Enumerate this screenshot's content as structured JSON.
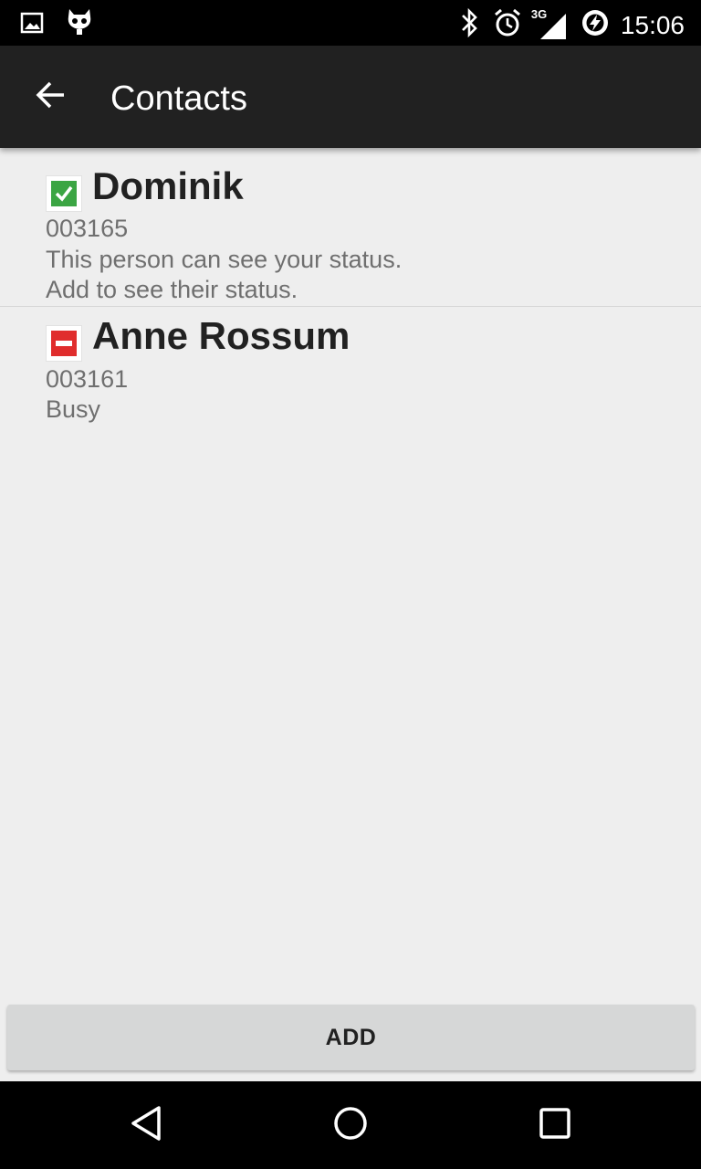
{
  "status_bar": {
    "time": "15:06",
    "network_label": "3G",
    "left_icons": [
      "image-notification-icon",
      "cyanogen-mascot-icon"
    ],
    "right_icons": [
      "bluetooth-icon",
      "alarm-icon",
      "signal-3g-icon",
      "battery-charging-icon"
    ]
  },
  "app_bar": {
    "title": "Contacts",
    "back_icon": "arrow-left-icon",
    "background": "#212121"
  },
  "contacts": [
    {
      "name": "Dominik",
      "number": "003165",
      "lines": [
        "This person can see your status.",
        "Add to see their status."
      ],
      "status_icon": "check-icon",
      "status_color": "#3ba543"
    },
    {
      "name": "Anne Rossum",
      "number": "003161",
      "lines": [
        "Busy"
      ],
      "status_icon": "busy-icon",
      "status_color": "#e02d2d"
    }
  ],
  "add_button": {
    "label": "ADD"
  },
  "nav_bar": {
    "icons": [
      "back-triangle-icon",
      "home-circle-icon",
      "recents-square-icon"
    ]
  },
  "colors": {
    "background": "#eeeeee",
    "name_text": "#212121",
    "secondary_text": "#6f6f6f",
    "button": "#d6d7d7"
  }
}
